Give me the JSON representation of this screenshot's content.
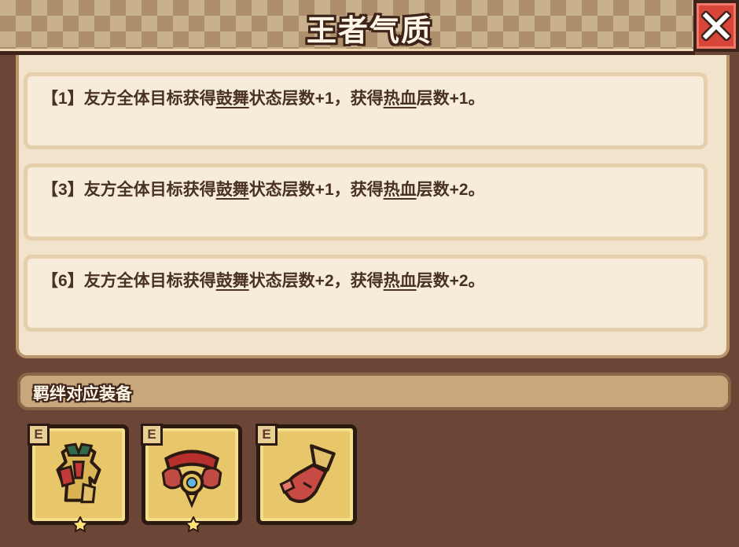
{
  "title": "王者气质",
  "effects": [
    {
      "tier": "【1】",
      "pre": "友方全体目标获得",
      "kw1": "鼓舞",
      "mid": "状态层数+1，获得",
      "kw2": "热血",
      "post": "层数+1。"
    },
    {
      "tier": "【3】",
      "pre": "友方全体目标获得",
      "kw1": "鼓舞",
      "mid": "状态层数+1，获得",
      "kw2": "热血",
      "post": "层数+2。"
    },
    {
      "tier": "【6】",
      "pre": "友方全体目标获得",
      "kw1": "鼓舞",
      "mid": "状态层数+2，获得",
      "kw2": "热血",
      "post": "层数+2。"
    }
  ],
  "gear_section": {
    "title": "羁绊对应装备",
    "items": [
      {
        "badge": "E",
        "icon": "armor-icon",
        "stars": 1
      },
      {
        "badge": "E",
        "icon": "amulet-icon",
        "stars": 1
      },
      {
        "badge": "E",
        "icon": "glove-icon",
        "stars": 0
      }
    ]
  },
  "colors": {
    "background": "#6b4535",
    "panel": "#f2e4cc",
    "close": "#d9453a",
    "slot": "#e8c66a"
  }
}
